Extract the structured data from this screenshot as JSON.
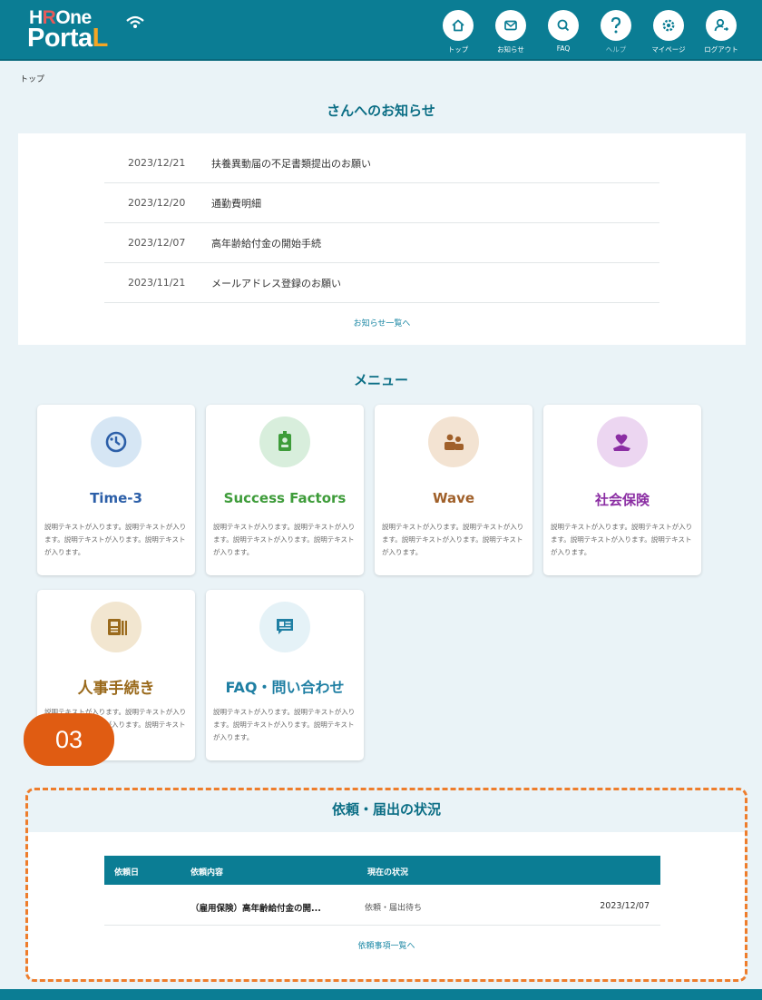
{
  "header": {
    "logo_line1_a": "H",
    "logo_line1_b": "R",
    "logo_line1_c": "One",
    "logo_line2_a": "Porta",
    "logo_line2_b": "L",
    "nav": [
      {
        "label": "トップ",
        "icon": "home-icon"
      },
      {
        "label": "お知らせ",
        "icon": "mail-icon"
      },
      {
        "label": "FAQ",
        "icon": "search-icon"
      },
      {
        "label": "ヘルプ",
        "icon": "help-icon"
      },
      {
        "label": "マイページ",
        "icon": "gear-icon"
      },
      {
        "label": "ログアウト",
        "icon": "logout-icon"
      }
    ]
  },
  "breadcrumb": "トップ",
  "notices": {
    "title": "さんへのお知らせ",
    "items": [
      {
        "date": "2023/12/21",
        "text": "扶養異動届の不足書類提出のお願い"
      },
      {
        "date": "2023/12/20",
        "text": "通勤費明細"
      },
      {
        "date": "2023/12/07",
        "text": "高年齢給付金の開始手続"
      },
      {
        "date": "2023/11/21",
        "text": "メールアドレス登録のお願い"
      }
    ],
    "more_link": "お知らせ一覧へ"
  },
  "menu": {
    "title": "メニュー",
    "cards": [
      {
        "title": "Time-3",
        "desc": "説明テキストが入ります。説明テキストが入ります。説明テキストが入ります。説明テキストが入ります。",
        "color": "#2c5fa8",
        "icon": "clock-icon"
      },
      {
        "title": "Success Factors",
        "desc": "説明テキストが入ります。説明テキストが入ります。説明テキストが入ります。説明テキストが入ります。",
        "color": "#3e9c3a",
        "icon": "id-badge-icon"
      },
      {
        "title": "Wave",
        "desc": "説明テキストが入ります。説明テキストが入ります。説明テキストが入ります。説明テキストが入ります。",
        "color": "#a0602a",
        "icon": "people-icon"
      },
      {
        "title": "社会保険",
        "desc": "説明テキストが入ります。説明テキストが入ります。説明テキストが入ります。説明テキストが入ります。",
        "color": "#8b2ea3",
        "icon": "heart-hand-icon"
      },
      {
        "title": "人事手続き",
        "desc": "説明テキストが入ります。説明テキストが入ります。説明テキストが入ります。説明テキストが入ります。",
        "color": "#9a6a1c",
        "icon": "document-icon"
      },
      {
        "title": "FAQ・問い合わせ",
        "desc": "説明テキストが入ります。説明テキストが入ります。説明テキストが入ります。説明テキストが入ります。",
        "color": "#1f7fa3",
        "icon": "chat-icon"
      }
    ]
  },
  "badge": "03",
  "status": {
    "title": "依頼・届出の状況",
    "headers": [
      "依頼日",
      "依頼内容",
      "現在の状況"
    ],
    "rows": [
      {
        "date": "",
        "content": "（雇用保険）高年齢給付金の開...",
        "state": "依頼・届出待ち",
        "updated": "2023/12/07"
      }
    ],
    "more_link": "依頼事項一覧へ"
  }
}
